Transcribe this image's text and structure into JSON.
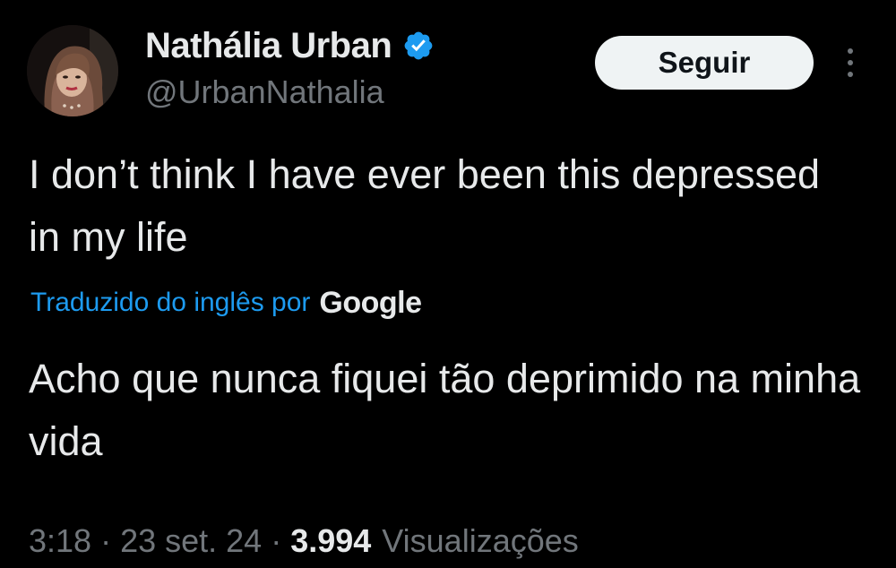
{
  "author": {
    "display_name": "Nathália Urban",
    "handle": "@UrbanNathalia",
    "verified_icon": "verified-badge-icon",
    "verified_color": "#1d9bf0"
  },
  "follow_button": {
    "label": "Seguir"
  },
  "more_menu_icon": "more-vertical-icon",
  "tweet": {
    "text": "I don’t think I have ever been this depressed in my life",
    "translated_by_label": "Traduzido do inglês por",
    "translator": "Google",
    "translated_text": "Acho que nunca fiquei tão deprimido na minha vida"
  },
  "meta": {
    "time": "3:18",
    "separator": "·",
    "date": "23 set. 24",
    "views_count": "3.994",
    "views_label": "Visualizações"
  },
  "colors": {
    "background": "#000000",
    "text_primary": "#e7e9ea",
    "text_secondary": "#71767b",
    "link": "#1d9bf0",
    "button_bg": "#eff3f4"
  }
}
